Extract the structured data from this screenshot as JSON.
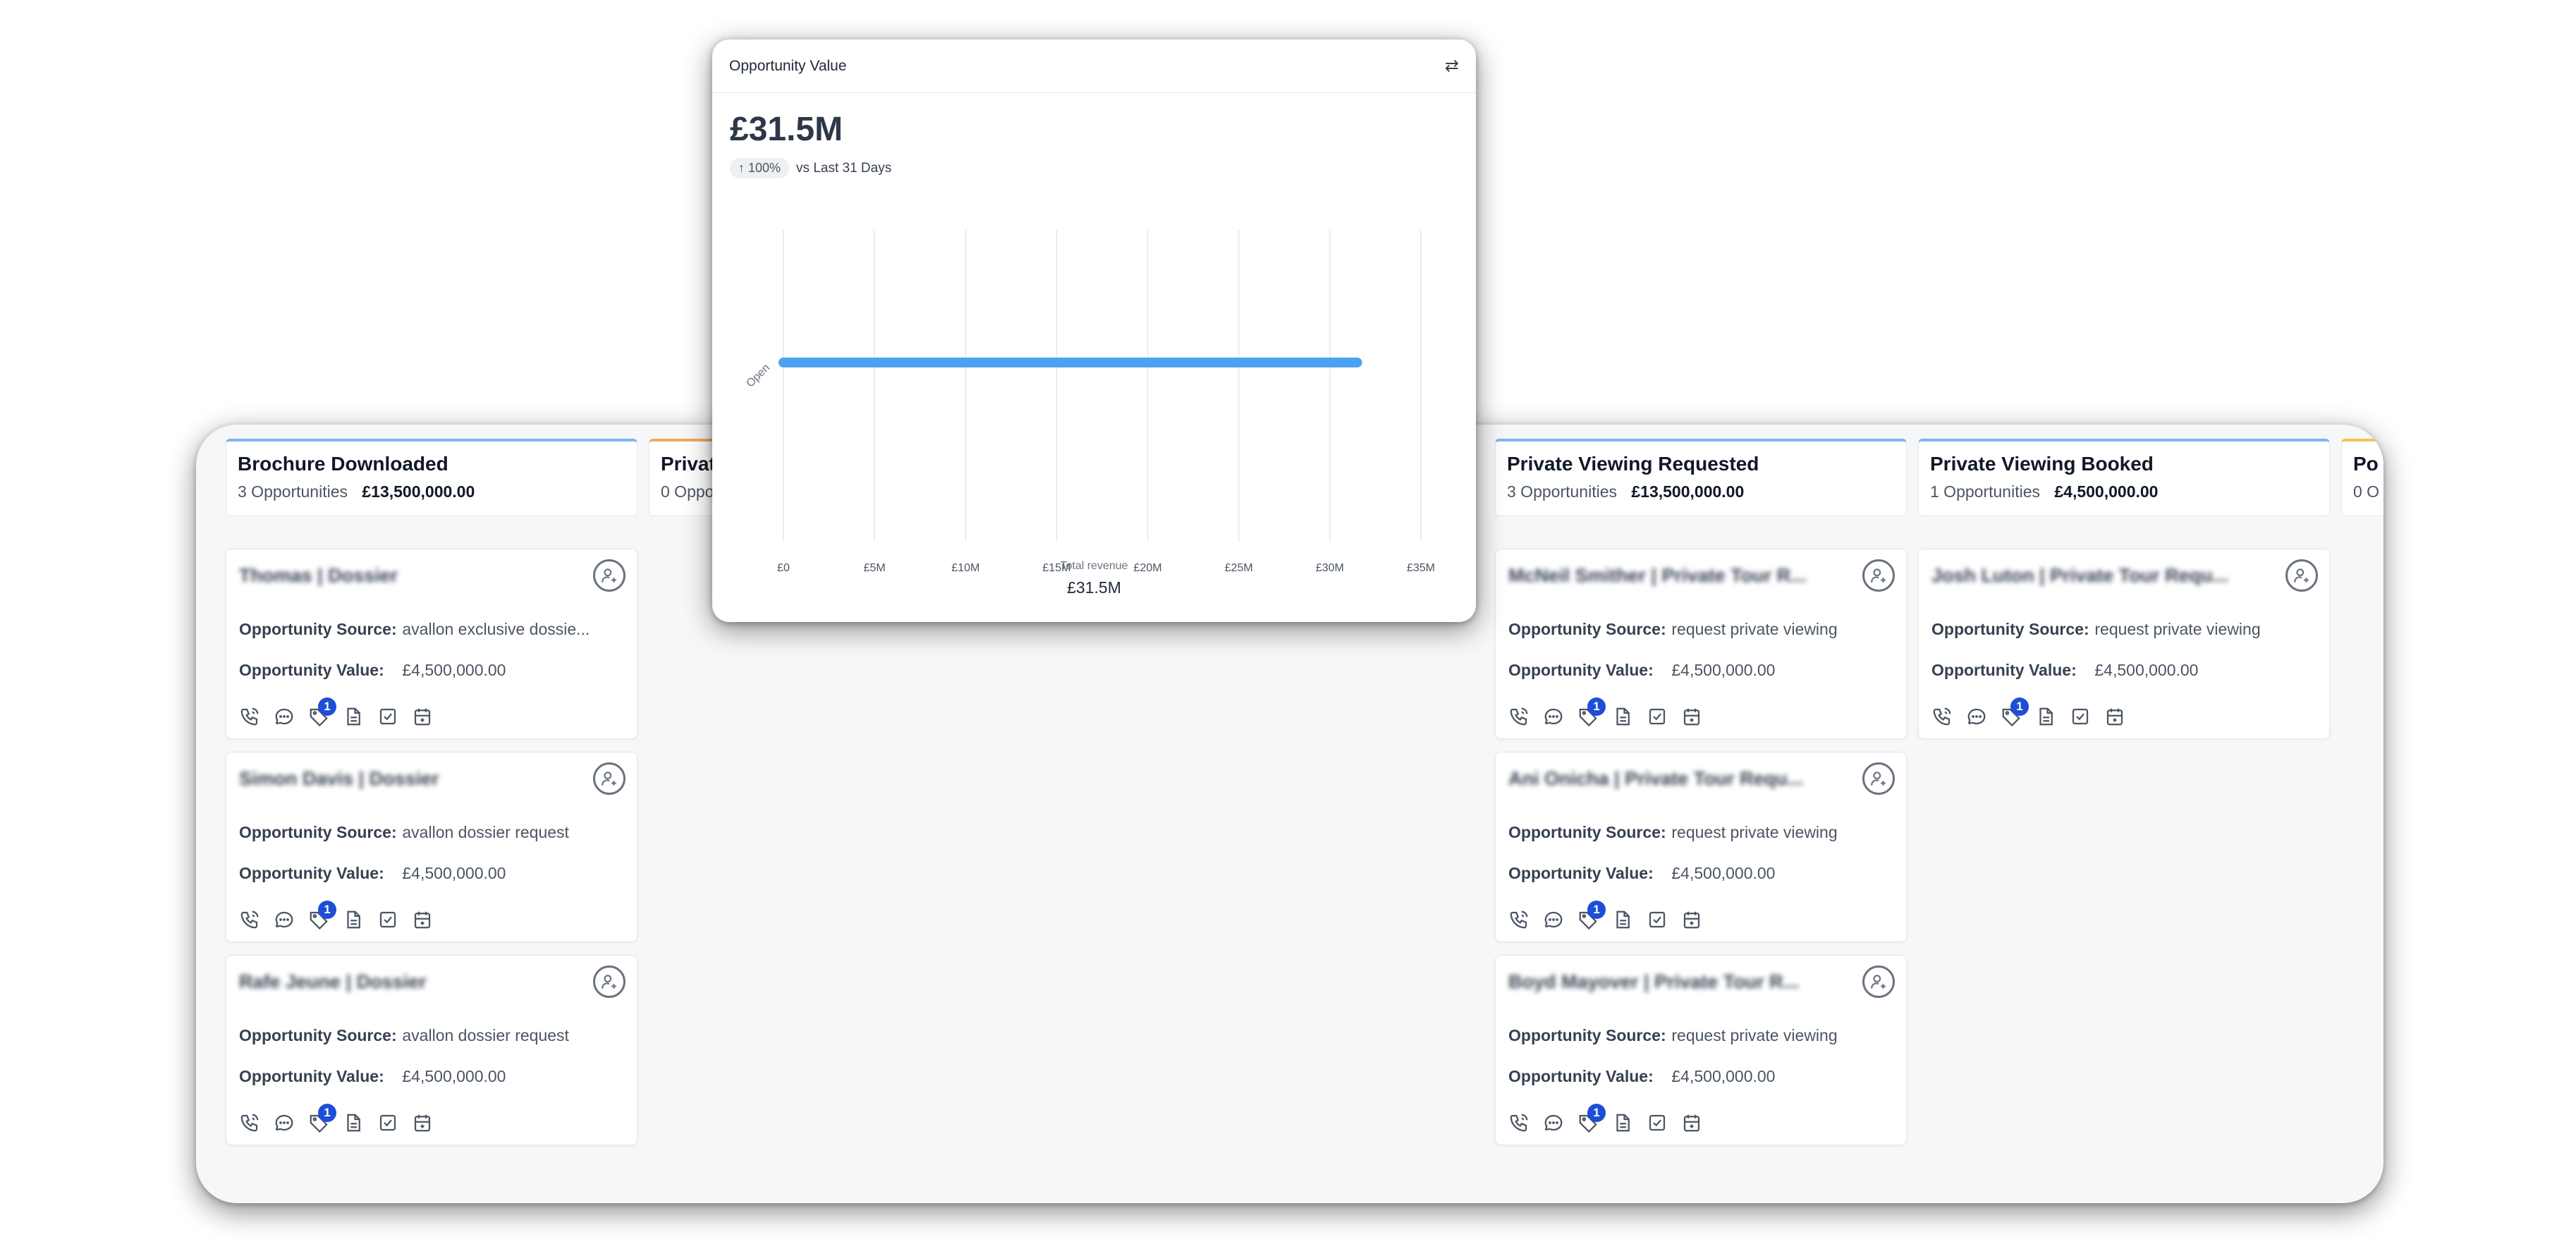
{
  "board": {
    "columns": [
      {
        "title": "Brochure Downloaded",
        "count": "3 Opportunities",
        "value": "£13,500,000.00",
        "cards": [
          {
            "name": "Thomas | Dossier",
            "source": "avallon exclusive dossie...",
            "value": "£4,500,000.00",
            "badge": "1"
          },
          {
            "name": "Simon Davis | Dossier",
            "source": "avallon dossier request",
            "value": "£4,500,000.00",
            "badge": "1"
          },
          {
            "name": "Rafe Jeune | Dossier",
            "source": "avallon dossier request",
            "value": "£4,500,000.00",
            "badge": "1"
          }
        ]
      },
      {
        "title": "Privat",
        "count": "0 Oppo",
        "value": "",
        "cards": []
      },
      {
        "title": "Private Viewing Requested",
        "count": "3 Opportunities",
        "value": "£13,500,000.00",
        "cards": [
          {
            "name": "McNeil Smither | Private Tour R...",
            "source": "request private viewing",
            "value": "£4,500,000.00",
            "badge": "1"
          },
          {
            "name": "Ani Onicha | Private Tour Requ...",
            "source": "request private viewing",
            "value": "£4,500,000.00",
            "badge": "1"
          },
          {
            "name": "Boyd Mayover | Private Tour R...",
            "source": "request private viewing",
            "value": "£4,500,000.00",
            "badge": "1"
          }
        ]
      },
      {
        "title": "Private Viewing Booked",
        "count": "1 Opportunities",
        "value": "£4,500,000.00",
        "cards": [
          {
            "name": "Josh Luton | Private Tour Requ...",
            "source": "request private viewing",
            "value": "£4,500,000.00",
            "badge": "1"
          }
        ]
      },
      {
        "title": "Po",
        "count": "0 O",
        "value": "",
        "cards": []
      }
    ],
    "labels": {
      "source": "Opportunity Source:",
      "value": "Opportunity Value:"
    }
  },
  "popup": {
    "title": "Opportunity Value",
    "total": "£31.5M",
    "trend_pct": "↑ 100%",
    "trend_text": "vs Last 31 Days",
    "footer_label": "Total revenue",
    "footer_value": "£31.5M"
  },
  "chart_data": {
    "type": "bar",
    "orientation": "horizontal",
    "categories": [
      "Open"
    ],
    "values": [
      31.5
    ],
    "unit": "£M",
    "xlim": [
      0,
      35
    ],
    "xticks": [
      "£0",
      "£5M",
      "£10M",
      "£15M",
      "£20M",
      "£25M",
      "£30M",
      "£35M"
    ],
    "xtick_values": [
      0,
      5,
      10,
      15,
      20,
      25,
      30,
      35
    ],
    "grid": true,
    "color": "#4ba3ef"
  }
}
